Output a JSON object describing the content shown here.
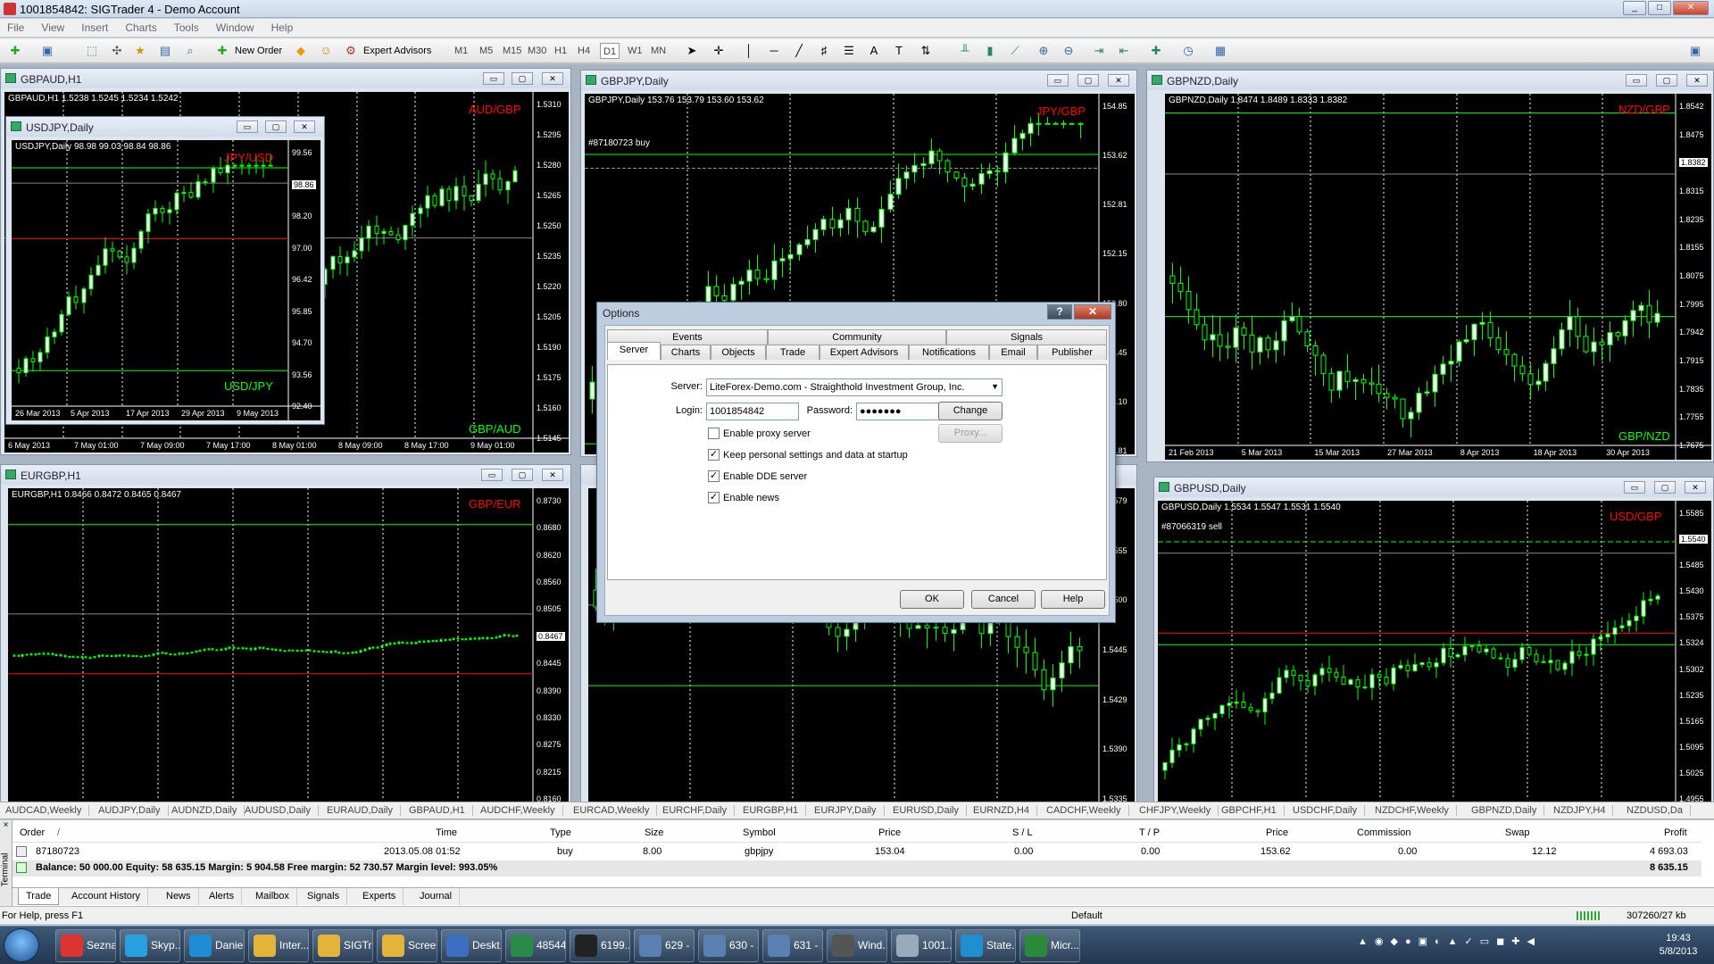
{
  "window": {
    "title": "1001854842: SIGTrader 4 - Demo Account",
    "controls": [
      "_",
      "□",
      "✕"
    ]
  },
  "menu": [
    "File",
    "View",
    "Insert",
    "Charts",
    "Tools",
    "Window",
    "Help"
  ],
  "toolbar": {
    "new_order": "New Order",
    "expert_advisors": "Expert Advisors",
    "periods": [
      "M1",
      "M5",
      "M15",
      "M30",
      "H1",
      "H4",
      "D1",
      "W1",
      "MN"
    ]
  },
  "charts": {
    "gbpaud": {
      "title": "GBPAUD,H1",
      "info": "GBPAUD,H1  1.5238 1.5245 1.5234 1.5242",
      "pair_top": "AUD/GBP",
      "pair_bottom": "GBP/AUD",
      "prices": [
        "1.5310",
        "1.5295",
        "1.5280",
        "1.5265",
        "1.5250",
        "1.5235",
        "1.5220",
        "1.5205",
        "1.5190",
        "1.5175",
        "1.5160",
        "1.5145"
      ],
      "current": "1.5242",
      "dates": [
        "6 May 2013",
        "7 May 01:00",
        "7 May 09:00",
        "7 May 17:00",
        "8 May 01:00",
        "8 May 09:00",
        "8 May 17:00",
        "9 May 01:00"
      ]
    },
    "usdjpy": {
      "title": "USDJPY,Daily",
      "info": "USDJPY,Daily  98.98 99.03 98.84 98.86",
      "pair_top": "JPY/USD",
      "pair_bottom": "USD/JPY",
      "prices": [
        "99.56",
        "98.86",
        "98.20",
        "97.00",
        "96.42",
        "95.85",
        "94.70",
        "93.56",
        "92.40"
      ],
      "current": "98.86",
      "dates": [
        "26 Mar 2013",
        "5 Apr 2013",
        "17 Apr 2013",
        "29 Apr 2013",
        "9 May 2013"
      ]
    },
    "gbpjpy": {
      "title": "GBPJPY,Daily",
      "info": "GBPJPY,Daily  153.76 153.79 153.60 153.62",
      "pair_top": "JPY/GBP",
      "order_label": "#87180723 buy",
      "prices": [
        "154.85",
        "153.62",
        "152.81",
        "152.15",
        "150.80",
        "149.45",
        "148.10",
        "146.81"
      ]
    },
    "gbpnzd": {
      "title": "GBPNZD,Daily",
      "info": "GBPNZD,Daily  1.8474 1.8489 1.8333 1.8382",
      "pair_top": "NZD/GBP",
      "pair_bottom": "GBP/NZD",
      "prices": [
        "1.8542",
        "1.8475",
        "1.8382",
        "1.8315",
        "1.8235",
        "1.8155",
        "1.8075",
        "1.7995",
        "1.7942",
        "1.7915",
        "1.7835",
        "1.7755",
        "1.7675"
      ],
      "current": "1.8382",
      "dates": [
        "21 Feb 2013",
        "5 Mar 2013",
        "15 Mar 2013",
        "27 Mar 2013",
        "8 Apr 2013",
        "18 Apr 2013",
        "30 Apr 2013"
      ]
    },
    "eurgbp": {
      "title": "EURGBP,H1",
      "info": "EURGBP,H1  0.8466 0.8472 0.8465 0.8467",
      "pair_top": "GBP/EUR",
      "prices": [
        "0.8730",
        "0.8680",
        "0.8620",
        "0.8560",
        "0.8505",
        "0.8467",
        "0.8445",
        "0.8390",
        "0.8330",
        "0.8275",
        "0.8215",
        "0.8160"
      ],
      "current": "0.8467"
    },
    "mid_lower": {
      "prices": [
        "1.5579",
        "1.5555",
        "1.5500",
        "1.5445",
        "1.5429",
        "1.5390",
        "1.5335"
      ]
    },
    "gbpusd": {
      "title": "GBPUSD,Daily",
      "info": "GBPUSD,Daily  1.5534 1.5547 1.5531 1.5540",
      "pair_top": "USD/GBP",
      "order_label": "#87066319 sell",
      "prices": [
        "1.5585",
        "1.5540",
        "1.5485",
        "1.5430",
        "1.5375",
        "1.5324",
        "1.5302",
        "1.5235",
        "1.5165",
        "1.5095",
        "1.5025",
        "1.4955"
      ],
      "current": "1.5540"
    }
  },
  "dialog": {
    "title": "Options",
    "help_btn": "?",
    "close_btn": "✕",
    "tabs_back": [
      "Events",
      "Community",
      "Signals"
    ],
    "tabs_front": [
      "Server",
      "Charts",
      "Objects",
      "Trade",
      "Expert Advisors",
      "Notifications",
      "Email",
      "Publisher"
    ],
    "server_label": "Server:",
    "server_value": "LiteForex-Demo.com - Straighthold Investment Group, Inc.",
    "login_label": "Login:",
    "login_value": "1001854842",
    "password_label": "Password:",
    "password_value": "●●●●●●●",
    "change_btn": "Change",
    "proxy_btn": "Proxy...",
    "checks": [
      {
        "label": "Enable proxy server",
        "checked": false,
        "mark": ""
      },
      {
        "label": "Keep personal settings and data at startup",
        "checked": true,
        "mark": "✓"
      },
      {
        "label": "Enable DDE server",
        "checked": true,
        "mark": "✓"
      },
      {
        "label": "Enable news",
        "checked": true,
        "mark": "✓"
      }
    ],
    "ok": "OK",
    "cancel": "Cancel",
    "help": "Help"
  },
  "symbol_tabs": [
    "AUDCAD,Weekly",
    "AUDJPY,Daily",
    "AUDNZD,Daily",
    "AUDUSD,Daily",
    "EURAUD,Daily",
    "GBPAUD,H1",
    "AUDCHF,Weekly",
    "EURCAD,Weekly",
    "EURCHF,Daily",
    "EURGBP,H1",
    "EURJPY,Daily",
    "EURUSD,Daily",
    "EURNZD,H4",
    "CADCHF,Weekly",
    "CHFJPY,Weekly",
    "GBPCHF,H1",
    "USDCHF,Daily",
    "NZDCHF,Weekly",
    "GBPNZD,Daily",
    "NZDJPY,H4",
    "NZDUSD,Da"
  ],
  "terminal": {
    "side_label": "Terminal",
    "headers": {
      "order": "Order",
      "time": "Time",
      "type": "Type",
      "size": "Size",
      "symbol": "Symbol",
      "price": "Price",
      "sl": "S / L",
      "tp": "T / P",
      "price2": "Price",
      "commission": "Commission",
      "swap": "Swap",
      "profit": "Profit"
    },
    "row": {
      "order": "87180723",
      "time": "2013.05.08 01:52",
      "type": "buy",
      "size": "8.00",
      "symbol": "gbpjpy",
      "price": "153.04",
      "sl": "0.00",
      "tp": "0.00",
      "price2": "153.62",
      "commission": "0.00",
      "swap": "12.12",
      "profit": "4 693.03"
    },
    "balance": "Balance: 50 000.00  Equity: 58 635.15  Margin: 5 904.58  Free margin: 52 730.57  Margin level: 993.05%",
    "balance_profit": "8 635.15",
    "tabs": [
      "Trade",
      "Account History",
      "News",
      "Alerts",
      "Mailbox",
      "Signals",
      "Experts",
      "Journal"
    ]
  },
  "status": {
    "help": "For Help, press F1",
    "profile": "Default",
    "traffic": "307260/27 kb"
  },
  "taskbar": {
    "items": [
      "Sezna...",
      "Skyp...",
      "Danie...",
      "Inter...",
      "SIGTr...",
      "Scree...",
      "Deskt...",
      "48544...",
      "6199...",
      "629 - ...",
      "630 - ...",
      "631 - ...",
      "Wind...",
      "1001...",
      "State...",
      "Micr..."
    ],
    "time": "19:43",
    "date": "5/8/2013"
  }
}
